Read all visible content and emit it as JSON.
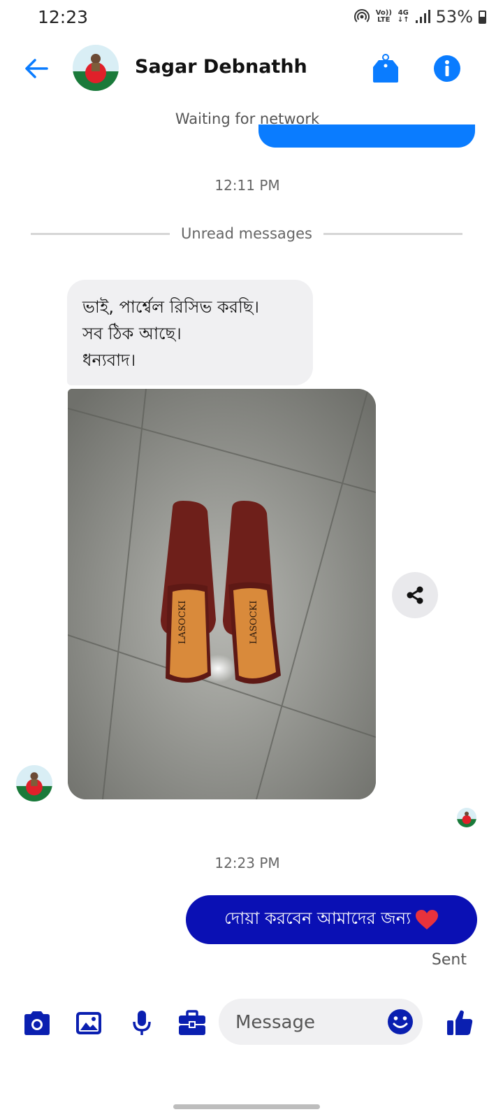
{
  "status_bar": {
    "time": "12:23",
    "volte_top": "Vo))",
    "volte_bottom": "LTE",
    "network_top": "4G",
    "network_bottom": "↓↑",
    "battery": "53%"
  },
  "header": {
    "contact_name": "Sagar Debnathh",
    "back_icon": "back-arrow-icon",
    "shop_icon": "shopping-bag-icon",
    "info_icon": "info-icon"
  },
  "thread": {
    "network_status": "Waiting for network",
    "timestamp_1": "12:11 PM",
    "unread_label": "Unread messages",
    "incoming_lines": [
      "ভাই, পার্শ্বেল রিসিভ করছি।",
      "সব ঠিক আছে।",
      "ধন্যবাদ।"
    ],
    "photo_brand_left": "LASOCKI",
    "photo_brand_right": "LASOCKI",
    "timestamp_2": "12:23 PM",
    "outgoing_text": "দোয়া করবেন আমাদের জন্য",
    "outgoing_emoji": "red-heart-icon",
    "sent_status": "Sent"
  },
  "composer": {
    "placeholder": "Message",
    "icons": [
      "camera-icon",
      "gallery-icon",
      "microphone-icon",
      "briefcase-icon",
      "emoji-icon",
      "thumbs-up-icon"
    ]
  },
  "colors": {
    "accent": "#0a7cff",
    "outgoing_bubble": "#0a10b4",
    "incoming_bubble": "#f0f0f2",
    "icon_navy": "#0a1fb0",
    "heart": "#e8323c"
  }
}
